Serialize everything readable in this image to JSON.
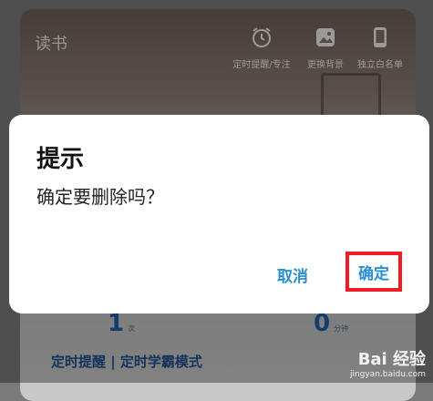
{
  "app": {
    "title": "读书",
    "tools": [
      {
        "label": "定时提醒/专注",
        "icon": "alarm-clock-icon"
      },
      {
        "label": "更换背景",
        "icon": "image-icon"
      },
      {
        "label": "独立白名单",
        "icon": "phone-icon"
      }
    ],
    "stats": [
      {
        "value": "1",
        "unit": "次"
      },
      {
        "value": "0",
        "unit": "分钟"
      }
    ],
    "bottom_link": "定时提醒 | 定时学霸模式"
  },
  "dialog": {
    "title": "提示",
    "message": "确定要删除吗？",
    "cancel_label": "取消",
    "confirm_label": "确定",
    "highlight_color": "#ee1c25",
    "button_color": "#2a8fd1"
  },
  "watermark": {
    "brand": "Bai 经验",
    "url": "jingyan.baidu.com"
  }
}
